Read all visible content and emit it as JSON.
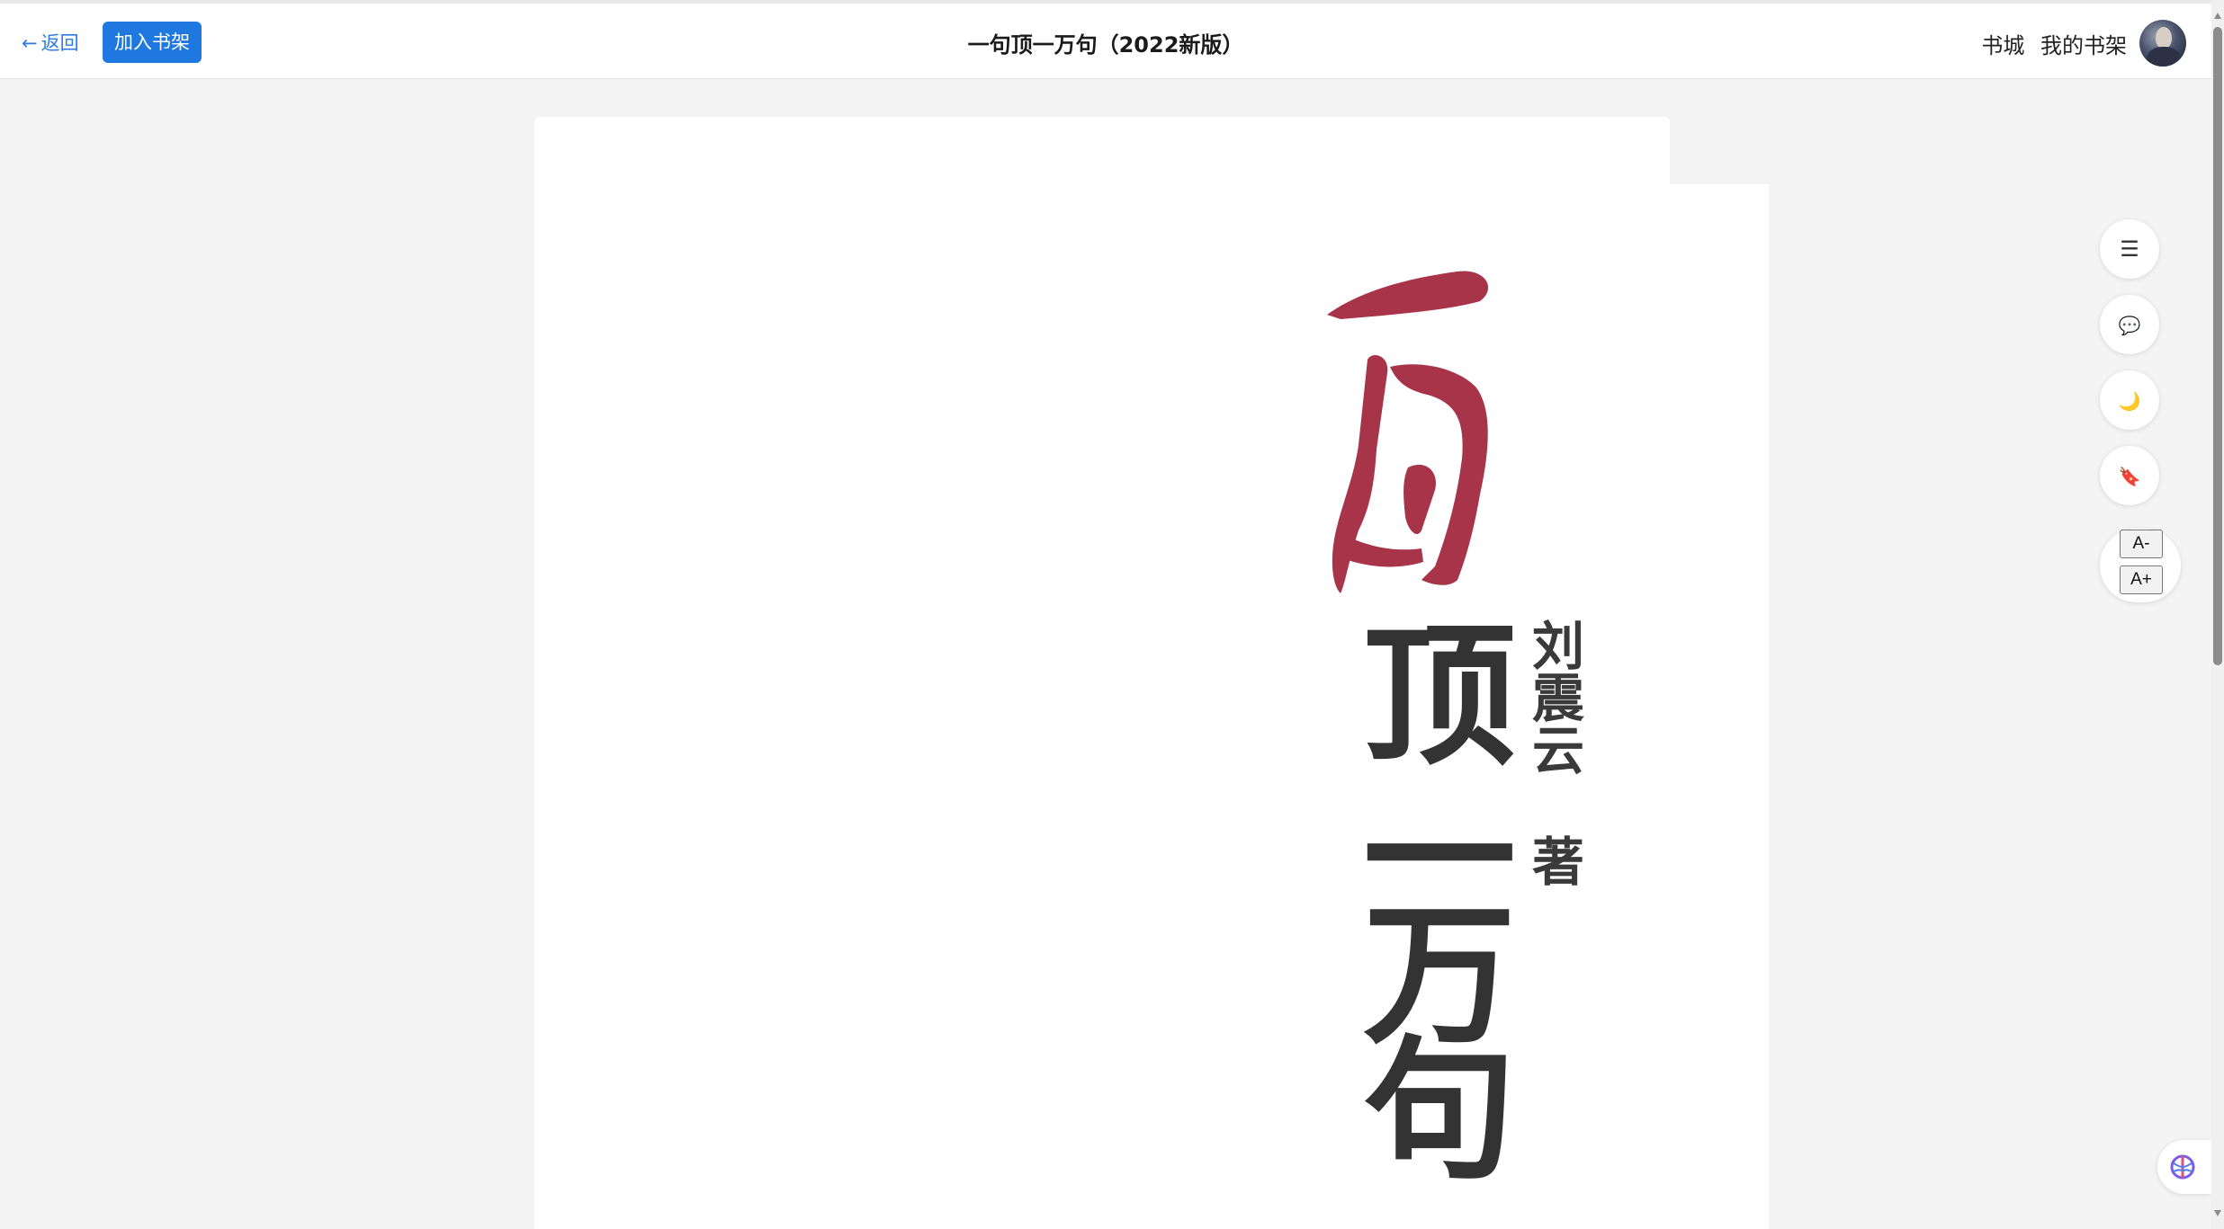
{
  "header": {
    "back_label": "返回",
    "back_arrow": "←",
    "add_to_shelf_label": "加入书架",
    "title": "一句顶一万句（2022新版）",
    "nav": [
      "书城",
      "我的书架"
    ]
  },
  "book_cover": {
    "title_chars": [
      "顶",
      "一",
      "万",
      "句"
    ],
    "author_chars": [
      "刘",
      "震",
      "云"
    ],
    "author_role": "著"
  },
  "tools": {
    "toc_icon": "☰",
    "comment_icon": "💬",
    "night_icon": "🌙",
    "bookmark_icon": "🔖",
    "font_decrease_label": "A-",
    "font_increase_label": "A+"
  },
  "colors": {
    "accent": "#1f78e0",
    "link": "#2d7be5",
    "calligraphy_red": "#a8344a"
  }
}
